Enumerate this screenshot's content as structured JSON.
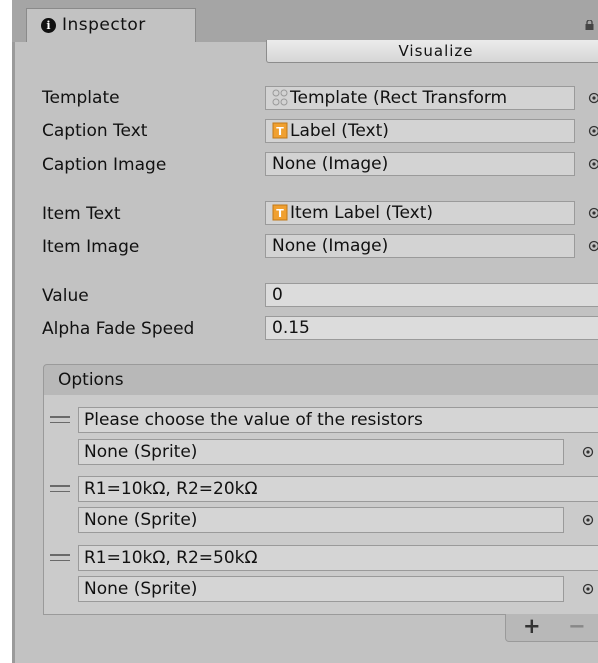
{
  "tab": {
    "title": "Inspector",
    "icon": "info-icon"
  },
  "toolbar": {
    "visualize_label": "Visualize"
  },
  "fields": {
    "template": {
      "label": "Template",
      "value": "Template (Rect Transform",
      "icon": "rect-transform-icon"
    },
    "caption_text": {
      "label": "Caption Text",
      "value": "Label (Text)",
      "icon": "text-component-icon"
    },
    "caption_image": {
      "label": "Caption Image",
      "value": "None (Image)"
    },
    "item_text": {
      "label": "Item Text",
      "value": "Item Label (Text)",
      "icon": "text-component-icon"
    },
    "item_image": {
      "label": "Item Image",
      "value": "None (Image)"
    },
    "value": {
      "label": "Value",
      "value": "0"
    },
    "alpha_fade_speed": {
      "label": "Alpha Fade Speed",
      "value": "0.15"
    }
  },
  "options": {
    "header": "Options",
    "items": [
      {
        "text": "Please choose the value of the resistors",
        "image": "None (Sprite)"
      },
      {
        "text": "R1=10kΩ, R2=20kΩ",
        "image": "None (Sprite)"
      },
      {
        "text": "R1=10kΩ, R2=50kΩ",
        "image": "None (Sprite)"
      }
    ],
    "add_label": "+",
    "remove_label": "−"
  },
  "colors": {
    "panel": "#c2c2c2",
    "tab_bar": "#a5a5a5",
    "text_icon": "#f0a030"
  }
}
